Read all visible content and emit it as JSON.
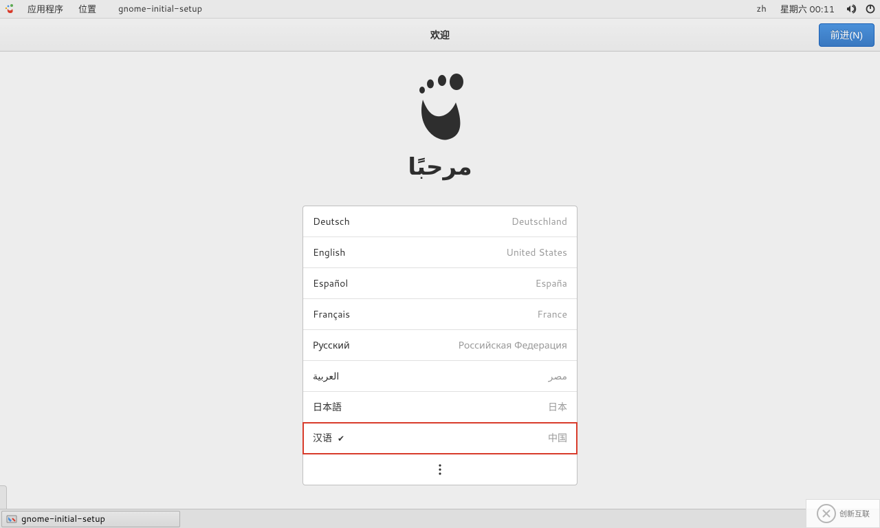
{
  "top_panel": {
    "applications": "应用程序",
    "places": "位置",
    "active_app": "gnome-initial-setup",
    "ime": "zh",
    "clock": "星期六 00:11"
  },
  "header": {
    "title": "欢迎",
    "next_button": "前进(N)"
  },
  "main": {
    "welcome_word": "مرحبًا"
  },
  "languages": [
    {
      "name": "Deutsch",
      "region": "Deutschland",
      "selected": false
    },
    {
      "name": "English",
      "region": "United States",
      "selected": false
    },
    {
      "name": "Español",
      "region": "España",
      "selected": false
    },
    {
      "name": "Français",
      "region": "France",
      "selected": false
    },
    {
      "name": "Русский",
      "region": "Российская Федерация",
      "selected": false
    },
    {
      "name": "العربية",
      "region": "مصر",
      "selected": false
    },
    {
      "name": "日本語",
      "region": "日本",
      "selected": false
    },
    {
      "name": "汉语",
      "region": "中国",
      "selected": true
    }
  ],
  "taskbar": {
    "task1": "gnome-initial-setup"
  },
  "watermark": {
    "text": "创新互联"
  },
  "colors": {
    "accent": "#3a78c0",
    "highlight_border": "#d83a2a",
    "panel_bg": "#e8e8e8",
    "body_bg": "#ededed"
  }
}
